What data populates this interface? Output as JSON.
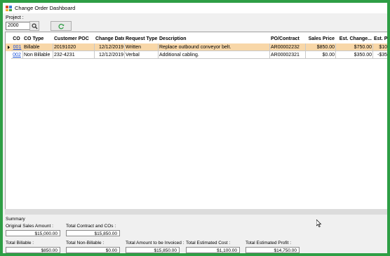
{
  "window": {
    "title": "Change Order Dashboard"
  },
  "project": {
    "label": "Project :",
    "value": "2000"
  },
  "grid": {
    "columns": [
      "CO",
      "CO Type",
      "Customer POC",
      "Change Date",
      "Request Type",
      "Description",
      "PO/Contract",
      "Sales Price",
      "Est. Change...",
      "Est. Pr..."
    ],
    "rows": [
      {
        "co": "001",
        "co_type": "Billable",
        "poc": "20191020",
        "date": "12/12/2019",
        "request_type": "Written",
        "description": "Replace outbound conveyor belt.",
        "po": "AR00002232",
        "sales_price": "$850.00",
        "est_change": "$750.00",
        "est_profit": "$10"
      },
      {
        "co": "002",
        "co_type": "Non Billable",
        "poc": "232-4231",
        "date": "12/12/2019",
        "request_type": "Verbal",
        "description": "Additional cabling.",
        "po": "AR00002321",
        "sales_price": "$0.00",
        "est_change": "$350.00",
        "est_profit": "-$35"
      }
    ]
  },
  "summary": {
    "title": "Summary",
    "original_sales_label": "Original Sales Amount :",
    "original_sales_value": "$15,000.00",
    "total_contract_label": "Total Contract and COs :",
    "total_contract_value": "$15,850.00",
    "total_billable_label": "Total Billable :",
    "total_billable_value": "$850.00",
    "total_non_billable_label": "Total Non-Billable :",
    "total_non_billable_value": "$0.00",
    "total_invoiced_label": "Total Amount to be Invoiced :",
    "total_invoiced_value": "$15,850.00",
    "total_est_cost_label": "Total Estimated Cost :",
    "total_est_cost_value": "$1,100.00",
    "total_est_profit_label": "Total Estimated Profit :",
    "total_est_profit_value": "$14,750.00"
  },
  "icons": {
    "search": "search-icon",
    "refresh": "refresh-icon",
    "app": "app-icon"
  },
  "colors": {
    "frame": "#2e9e45",
    "selected_row": "#f8d7a8",
    "link": "#1a4fd6"
  }
}
